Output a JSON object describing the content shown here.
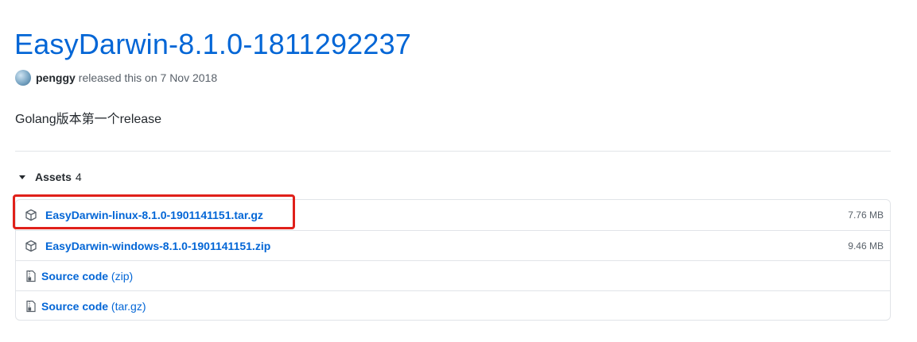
{
  "release": {
    "title": "EasyDarwin-8.1.0-1811292237",
    "author": "penggy",
    "released_text": "released this on 7 Nov 2018",
    "description": "Golang版本第一个release"
  },
  "assets": {
    "label": "Assets",
    "count": "4",
    "items": [
      {
        "name": "EasyDarwin-linux-8.1.0-1901141151.tar.gz",
        "size": "7.76 MB",
        "icon": "package-icon"
      },
      {
        "name": "EasyDarwin-windows-8.1.0-1901141151.zip",
        "size": "9.46 MB",
        "icon": "package-icon"
      },
      {
        "name": "Source code",
        "suffix": "(zip)",
        "icon": "file-zip-icon"
      },
      {
        "name": "Source code",
        "suffix": "(tar.gz)",
        "icon": "file-zip-icon"
      }
    ]
  },
  "colors": {
    "link": "#0366d6",
    "highlight": "#e0201a",
    "border": "#e1e4e8",
    "muted": "#586069"
  }
}
